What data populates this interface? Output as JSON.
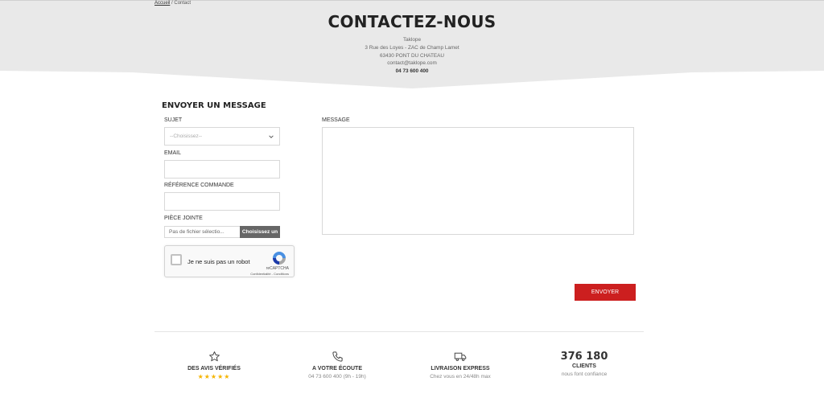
{
  "breadcrumb": {
    "home": "Accueil",
    "separator": " / ",
    "current": "Contact"
  },
  "header": {
    "title": "CONTACTEZ-NOUS",
    "company": "Taklope",
    "address": "3 Rue des Loyes - ZAC de Champ Lamet",
    "city": "63430 PONT DU CHATEAU",
    "email": "contact@taklope.com",
    "phone": "04 73 600 400"
  },
  "form": {
    "title": "ENVOYER UN MESSAGE",
    "subject_label": "SUJET",
    "subject_value": "--Choisissez--",
    "email_label": "EMAIL",
    "reference_label": "RÉFÉRENCE COMMANDE",
    "attachment_label": "PIÈCE JOINTE",
    "attachment_filename": "Pas de fichier sélectio...",
    "attachment_button": "Choisissez un",
    "message_label": "MESSAGE",
    "captcha_text": "Je ne suis pas un robot",
    "captcha_brand": "reCAPTCHA",
    "captcha_links": "Confidentialité - Conditions",
    "submit": "ENVOYER"
  },
  "features": [
    {
      "icon": "star-outline-icon",
      "title": "DES AVIS VÉRIFIÉS",
      "rating_stars": 5,
      "stars_text": "★★★★★"
    },
    {
      "icon": "phone-icon",
      "title": "A VOTRE ÉCOUTE",
      "subtitle": "04 73 600 400 (9h - 19h)"
    },
    {
      "icon": "truck-icon",
      "title": "LIVRAISON EXPRESS",
      "subtitle": "Chez vous en 24/48h max"
    },
    {
      "number": "376 180",
      "title": "CLIENTS",
      "subtitle": "nous font confiance"
    }
  ],
  "colors": {
    "hero_bg": "#e9e9e9",
    "accent_red": "#cc1f1f",
    "star_yellow": "#f5b400",
    "file_button": "#666666"
  }
}
